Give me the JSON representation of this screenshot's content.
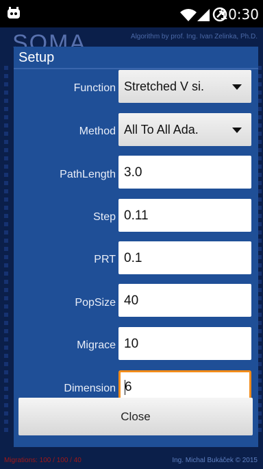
{
  "status_bar": {
    "time": "10:30",
    "icons": [
      "app-notification-icon",
      "wifi-icon",
      "signal-icon",
      "sync-icon"
    ]
  },
  "background": {
    "logo": "SOMA",
    "credit_top": "Algorithm by prof. Ing. Ivan Zelinka, Ph.D.",
    "credit_bottom": "Ing. Michal Bukáček © 2015",
    "red_text": "Migrations: 100 / 100 / 40"
  },
  "dialog": {
    "title": "Setup",
    "fields": [
      {
        "label": "Function",
        "type": "dropdown",
        "value": "Stretched V si."
      },
      {
        "label": "Method",
        "type": "dropdown",
        "value": "All To All Ada."
      },
      {
        "label": "PathLength",
        "type": "text",
        "value": "3.0"
      },
      {
        "label": "Step",
        "type": "text",
        "value": "0.11"
      },
      {
        "label": "PRT",
        "type": "text",
        "value": "0.1"
      },
      {
        "label": "PopSize",
        "type": "text",
        "value": "40"
      },
      {
        "label": "Migrace",
        "type": "text",
        "value": "10"
      },
      {
        "label": "Dimension",
        "type": "text",
        "value": "6",
        "focused": true
      }
    ],
    "close_label": "Close"
  },
  "colors": {
    "dialog_bg": "#1f4f97",
    "focus_border": "#f28c1a",
    "app_bg": "#0b1f4a"
  }
}
